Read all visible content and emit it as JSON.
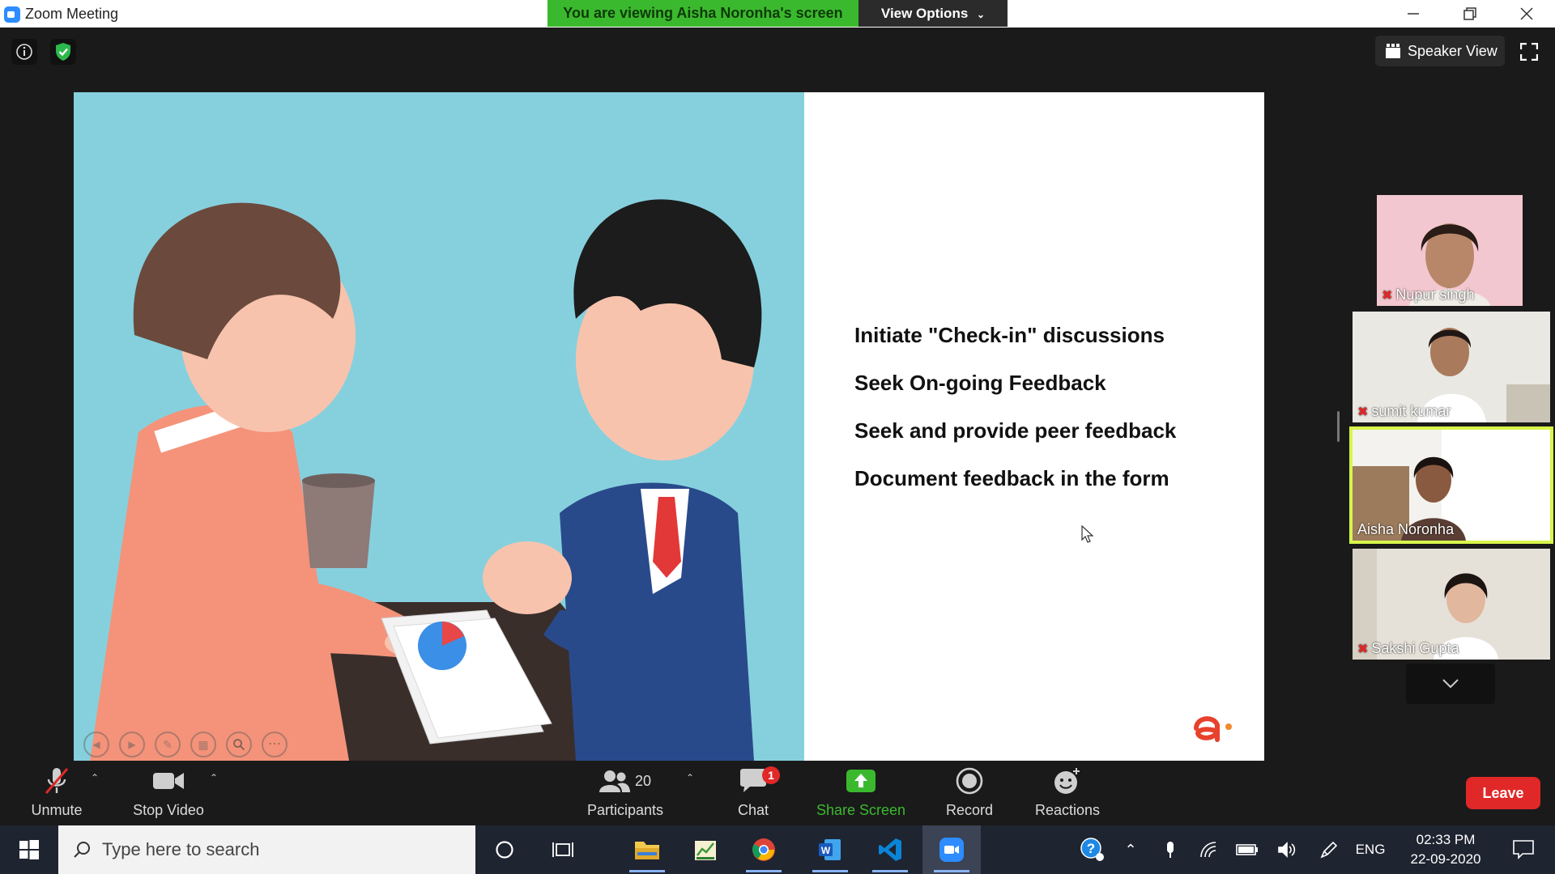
{
  "window": {
    "title": "Zoom Meeting",
    "viewing_banner": "You are viewing Aisha Noronha's screen",
    "view_options": "View Options"
  },
  "header": {
    "speaker_view": "Speaker View"
  },
  "slide": {
    "bullets": [
      "Initiate \"Check-in\" discussions",
      "Seek On-going Feedback",
      "Seek and provide peer feedback",
      "Document feedback in the form"
    ]
  },
  "participants": [
    {
      "name": "Nupur singh",
      "muted": true,
      "active": false
    },
    {
      "name": "sumit kumar",
      "muted": true,
      "active": false
    },
    {
      "name": "Aisha Noronha",
      "muted": false,
      "active": true
    },
    {
      "name": "Sakshi Gupta",
      "muted": true,
      "active": false
    }
  ],
  "toolbar": {
    "unmute": "Unmute",
    "stop_video": "Stop Video",
    "participants_count": "20",
    "participants": "Participants",
    "chat": "Chat",
    "chat_badge": "1",
    "share_screen": "Share Screen",
    "record": "Record",
    "reactions": "Reactions",
    "leave": "Leave"
  },
  "taskbar": {
    "search_placeholder": "Type here to search",
    "language": "ENG",
    "time": "02:33 PM",
    "date": "22-09-2020"
  },
  "colors": {
    "share_screen_green": "#3bb92e",
    "leave_red": "#e02828",
    "active_speaker_outline": "#d7f54a",
    "zoom_blue": "#2d8cff"
  }
}
